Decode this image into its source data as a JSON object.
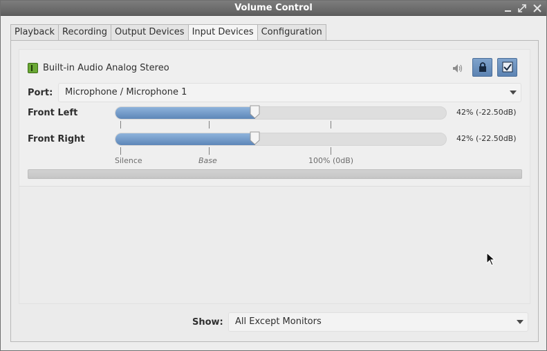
{
  "window": {
    "title": "Volume Control"
  },
  "tabs": [
    {
      "label": "Playback",
      "active": false
    },
    {
      "label": "Recording",
      "active": false
    },
    {
      "label": "Output Devices",
      "active": false
    },
    {
      "label": "Input Devices",
      "active": true
    },
    {
      "label": "Configuration",
      "active": false
    }
  ],
  "device": {
    "name": "Built-in Audio Analog Stereo",
    "icon": "audio-card-icon",
    "port_label": "Port:",
    "port_value": "Microphone / Microphone 1",
    "channels": [
      {
        "label": "Front Left",
        "value_text": "42% (-22.50dB)",
        "level": 0.42
      },
      {
        "label": "Front Right",
        "value_text": "42% (-22.50dB)",
        "level": 0.42
      }
    ],
    "scale_marks": {
      "silence": "Silence",
      "base": "Base",
      "full": "100% (0dB)"
    },
    "mute_toggled": false,
    "lock_toggled": true,
    "default_checked": true
  },
  "footer": {
    "show_label": "Show:",
    "show_value": "All Except Monitors"
  },
  "colors": {
    "accent": "#5c83b3",
    "titlebar": "#6e6e6e",
    "device_icon": "#6aa835"
  }
}
